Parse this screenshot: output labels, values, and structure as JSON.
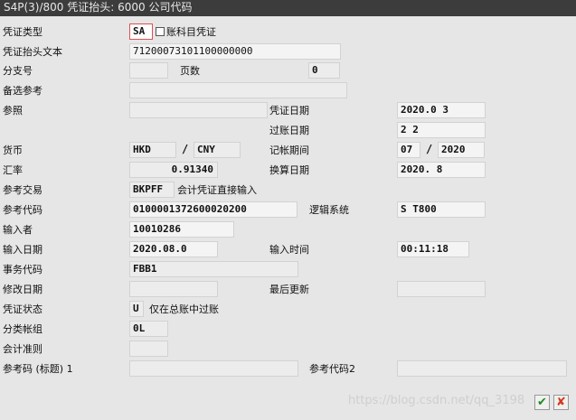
{
  "window": {
    "title": "S4P(3)/800 凭证抬头: 6000 公司代码"
  },
  "labels": {
    "doc_type": "凭证类型",
    "account_doc": "账科目凭证",
    "doc_header_text": "凭证抬头文本",
    "branch_no": "分支号",
    "page_count": "页数",
    "alt_ref": "备选参考",
    "reference": "参照",
    "doc_date": "凭证日期",
    "posting_date": "过账日期",
    "currency": "货币",
    "posting_period": "记帐期间",
    "exchange_rate": "汇率",
    "translation_date": "换算日期",
    "ref_transaction": "参考交易",
    "ref_code": "参考代码",
    "logical_system": "逻辑系统",
    "entered_by": "输入者",
    "entry_date": "输入日期",
    "entry_time": "输入时间",
    "transaction_code": "事务代码",
    "change_date": "修改日期",
    "last_update": "最后更新",
    "doc_status": "凭证状态",
    "status_desc": "仅在总账中过账",
    "ledger_group": "分类帐组",
    "accounting_principle": "会计准则",
    "ref_key_header1": "参考码 (标题) 1",
    "ref_key2": "参考代码2"
  },
  "values": {
    "doc_type": "SA",
    "doc_header_text": "71200073101100000000",
    "branch_no": "",
    "page_count": "0",
    "alt_ref": "",
    "reference": "",
    "doc_date": "2020.0  3",
    "posting_date": "2    2",
    "currency": "HKD",
    "currency_sep": "/",
    "currency2": "CNY",
    "period": "07",
    "period_sep": "/",
    "fiscal_year": "2020",
    "exchange_rate": "0.91340",
    "translation_date": "2020.  8",
    "ref_transaction": "BKPFF",
    "ref_transaction_desc": "会计凭证直接输入",
    "ref_code": "0100001372600020200",
    "logical_system": "S    T800",
    "entered_by": "10010286",
    "entry_date": "2020.08.0",
    "entry_time": "00:11:18",
    "transaction_code": "FBB1",
    "change_date": "",
    "last_update": "",
    "doc_status": "U",
    "ledger_group": "0L",
    "accounting_principle": "",
    "ref_key_header1": "",
    "ref_key2": ""
  },
  "buttons": {
    "ok_icon": "✔",
    "cancel_icon": "✘"
  },
  "watermark": "https://blog.csdn.net/qq_3198"
}
